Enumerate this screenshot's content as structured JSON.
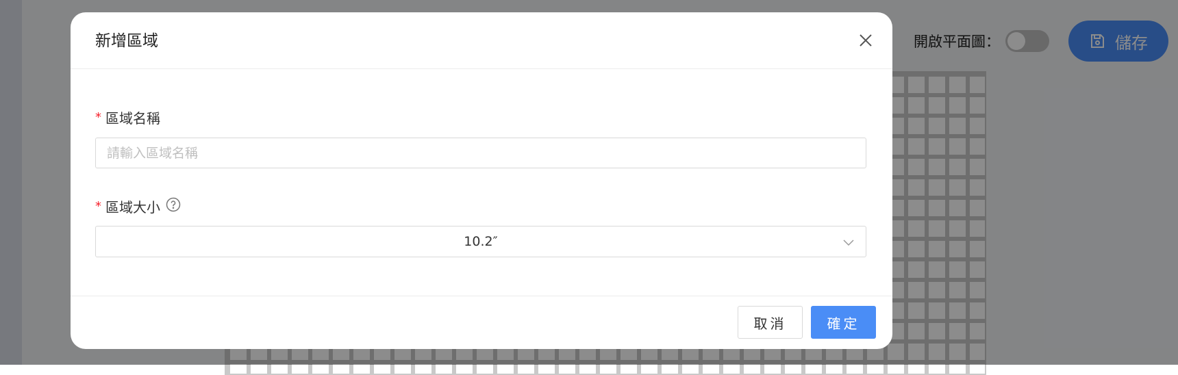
{
  "background": {
    "plan_toggle_label": "開啟平面圖：",
    "plan_toggle_on": false,
    "save_label": "儲存"
  },
  "modal": {
    "title": "新增區域",
    "fields": {
      "name": {
        "label": "區域名稱",
        "value": "",
        "placeholder": "請輸入區域名稱",
        "required": true
      },
      "size": {
        "label": "區域大小",
        "selected": "10.2″",
        "required": true
      }
    },
    "buttons": {
      "cancel": "取消",
      "ok": "確定"
    }
  },
  "colors": {
    "primary": "#4a8df6",
    "required": "#f5222d",
    "mask": "rgba(0,0,0,0.45)"
  },
  "icons": {
    "close": "close-icon",
    "help": "question-circle-icon",
    "select_arrow": "chevron-down-icon",
    "save": "floppy-disk-icon"
  }
}
